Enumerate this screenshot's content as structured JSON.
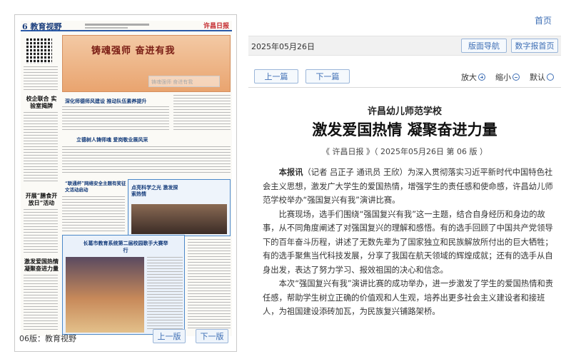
{
  "left": {
    "page_label": "6",
    "page_name": "教育视野",
    "banner_title": "铸魂强师 奋进有我",
    "watermark": "铸魂强师 奋进有我",
    "stories": [
      "深化师德师风建设 推动队伍素养提升",
      "立德树人铸师魂 爱岗敬业展风采",
      "“联通杯”网络安全主题有奖征文活动启动",
      "长葛市教育系统第二届校园歌手大赛举行",
      "点亮科学之光 激发探索热情"
    ],
    "side_titles": [
      "校企联合 实验室揭牌",
      "开展“膳食开放日”活动",
      "激发爱国热情 凝聚奋进力量"
    ],
    "caption": "06版：教育视野",
    "prev_page": "上一版",
    "next_page": "下一版"
  },
  "right": {
    "home": "首页",
    "date": "2025年05月26日",
    "layout_nav": "版面导航",
    "digital_home": "数字报首页",
    "prev_article": "上一篇",
    "next_article": "下一篇",
    "zoom_in": "放大",
    "zoom_out": "缩小",
    "default": "默认"
  },
  "article": {
    "subhead": "许昌幼儿师范学校",
    "headline": "激发爱国热情 凝聚奋进力量",
    "source": "《 许昌日报 》（ 2025年05月26日 第 06 版 ）",
    "lead_label": "本报讯",
    "lead": "（记者 吕正子 通讯员 王欣）为深入贯彻落实习近平新时代中国特色社会主义思想，激发广大学生的爱国热情，增强学生的责任感和使命感，许昌幼儿师范学校举办“强国复兴有我”演讲比赛。",
    "para2": "比赛现场，选手们围绕“强国复兴有我”这一主题，结合自身经历和身边的故事，从不同角度阐述了对强国复兴的理解和感悟。有的选手回顾了中国共产党领导下的百年奋斗历程，讲述了无数先辈为了国家独立和民族解放所付出的巨大牺牲；有的选手聚焦当代科技发展，分享了我国在航天领域的辉煌成就；还有的选手从自身出发，表达了努力学习、报效祖国的决心和信念。",
    "para3": "本次“强国复兴有我”演讲比赛的成功举办，进一步激发了学生的爱国热情和责任感，帮助学生树立正确的价值观和人生观，培养出更多社会主义建设者和接班人，为祖国建设添砖加瓦，为民族复兴铺路架桥。"
  }
}
